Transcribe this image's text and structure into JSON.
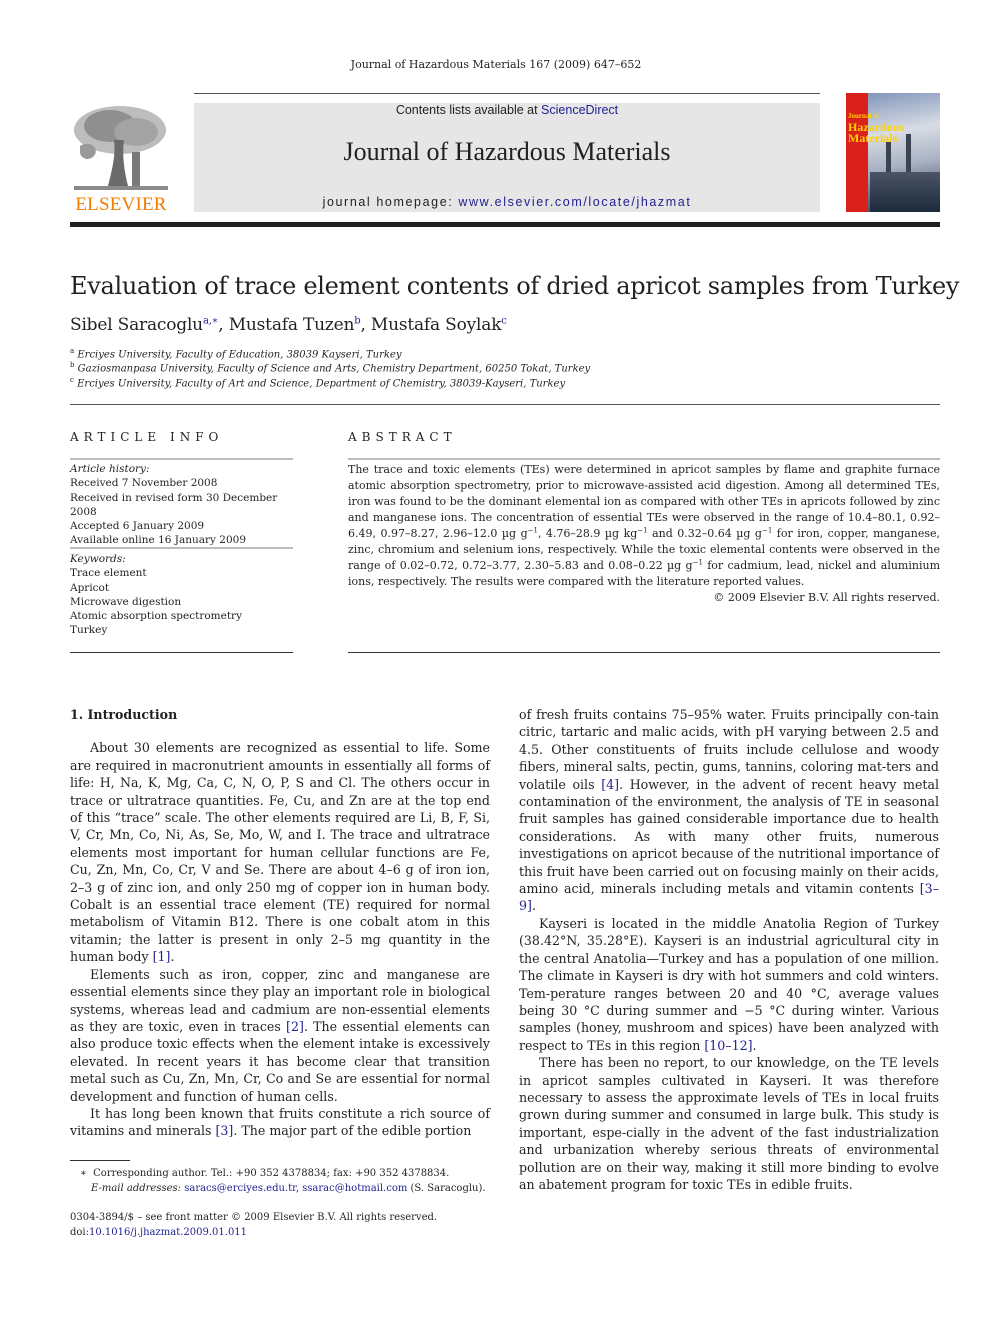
{
  "running_head": "Journal of Hazardous Materials 167 (2009) 647–652",
  "header": {
    "publisher_logo_text": "ELSEVIER",
    "contents_prefix": "Contents lists available at ",
    "contents_link": "ScienceDirect",
    "journal_title": "Journal of Hazardous Materials",
    "homepage_prefix": "journal homepage: ",
    "homepage_link": "www.elsevier.com/locate/jhazmat",
    "cover_title_line1": "Journal of",
    "cover_title_line2": "Hazardous",
    "cover_title_line3": "Materials",
    "colors": {
      "elsevier_orange": "#f07d00",
      "link_blue": "#1f1f8f",
      "masthead_gray": "#e6e6e6",
      "cover_red": "#d9201a"
    }
  },
  "article": {
    "title": "Evaluation of trace element contents of dried apricot samples from Turkey",
    "authors": [
      {
        "name": "Sibel Saracoglu",
        "sup": "a,∗",
        "sep": ", "
      },
      {
        "name": "Mustafa Tuzen",
        "sup": "b",
        "sep": ", "
      },
      {
        "name": "Mustafa Soylak",
        "sup": "c",
        "sep": ""
      }
    ],
    "affiliations": [
      {
        "key": "a",
        "text": "Erciyes University, Faculty of Education, 38039 Kayseri, Turkey"
      },
      {
        "key": "b",
        "text": "Gaziosmanpasa University, Faculty of Science and Arts, Chemistry Department, 60250 Tokat, Turkey"
      },
      {
        "key": "c",
        "text": "Erciyes University, Faculty of Art and Science, Department of Chemistry, 38039-Kayseri, Turkey"
      }
    ]
  },
  "article_info": {
    "heading": "ARTICLE INFO",
    "history_label": "Article history:",
    "history": [
      "Received 7 November 2008",
      "Received in revised form 30 December 2008",
      "Accepted 6 January 2009",
      "Available online 16 January 2009"
    ],
    "keywords_label": "Keywords:",
    "keywords": [
      "Trace element",
      "Apricot",
      "Microwave digestion",
      "Atomic absorption spectrometry",
      "Turkey"
    ]
  },
  "abstract": {
    "heading": "ABSTRACT",
    "part1": "The trace and toxic elements (TEs) were determined in apricot samples by flame and graphite furnace atomic absorption spectrometry, prior to microwave-assisted acid digestion. Among all determined TEs, iron was found to be the dominant elemental ion as compared with other TEs in apricots followed by zinc and manganese ions. The concentration of essential TEs were observed in the range of 10.4–80.1, 0.92–6.49, 0.97–8.27, 2.96–12.0 µg g",
    "part2": ", 4.76–28.9 µg kg",
    "part3": " and 0.32–0.64 µg g",
    "part4": " for iron, copper, manganese, zinc, chromium and selenium ions, respectively. While the toxic elemental contents were observed in the range of 0.02–0.72, 0.72–3.77, 2.30–5.83 and 0.08–0.22 µg g",
    "part5": " for cadmium, lead, nickel and aluminium ions, respectively. The results were compared with the literature reported values.",
    "exponent": "−1",
    "copyright": "© 2009 Elsevier B.V. All rights reserved."
  },
  "body": {
    "section_heading": "1.  Introduction",
    "left": {
      "p1a": "About 30 elements are recognized as essential to life. Some are required in macronutrient amounts in essentially all forms of life: H, Na, K, Mg, Ca, C, N, O, P, S and Cl. The others occur in trace or ultratrace quantities. Fe, Cu, and Zn are at the top end of this “trace” scale. The other elements required are Li, B, F, Si, V, Cr, Mn, Co, Ni, As, Se, Mo, W, and I. The trace and ultratrace elements most important for human cellular functions are Fe, Cu, Zn, Mn, Co, Cr, V and Se. There are about 4–6 g of iron ion, 2–3 g of zinc ion, and only 250 mg of copper ion in human body. Cobalt is an essential trace element (TE) required for normal metabolism of Vitamin B12. There is one cobalt atom in this vitamin; the latter is present in only 2–5 mg quantity in the human body ",
      "p1ref": "[1]",
      "p1b": ".",
      "p2a": "Elements such as iron, copper, zinc and manganese are essential elements since they play an important role in biological systems, whereas lead and cadmium are non-essential elements as they are toxic, even in traces ",
      "p2ref": "[2]",
      "p2b": ". The essential elements can also produce toxic effects when the element intake is excessively elevated. In recent years it has become clear that transition metal such as Cu, Zn, Mn, Cr, Co and Se are essential for normal development and function of human cells.",
      "p3a": "It has long been known that fruits constitute a rich source of vitamins and minerals ",
      "p3ref": "[3]",
      "p3b": ". The major part of the edible portion"
    },
    "right": {
      "p1a": "of fresh fruits contains 75–95% water. Fruits principally con-tain citric, tartaric and malic acids, with pH varying between 2.5 and 4.5. Other constituents of fruits include cellulose and woody fibers, mineral salts, pectin, gums, tannins, coloring mat-ters and volatile oils ",
      "p1ref1": "[4]",
      "p1b": ". However, in the advent of recent heavy metal contamination of the environment, the analysis of TE in seasonal fruit samples has gained considerable importance due to health considerations. As with many other fruits, numerous investigations on apricot because of the nutritional importance of this fruit have been carried out on focusing mainly on their acids, amino acid, minerals including metals and vitamin contents ",
      "p1ref2": "[3–9]",
      "p1c": ".",
      "p2a": "Kayseri is located in the middle Anatolia Region of Turkey (38.42°N, 35.28°E). Kayseri is an industrial agricultural city in the central Anatolia—Turkey and has a population of one million. The climate in Kayseri is dry with hot summers and cold winters. Tem-perature ranges between 20 and 40 °C, average values being 30 °C during summer and −5 °C during winter. Various samples (honey, mushroom and spices) have been analyzed with respect to TEs in this region ",
      "p2ref": "[10–12]",
      "p2b": ".",
      "p3": "There has been no report, to our knowledge, on the TE levels in apricot samples cultivated in Kayseri. It was therefore necessary to assess the approximate levels of TEs in local fruits grown during summer and consumed in large bulk. This study is important, espe-cially in the advent of the fast industrialization and urbanization whereby serious threats of environmental pollution are on their way, making it still more binding to evolve an abatement program for toxic TEs in edible fruits."
    }
  },
  "footnotes": {
    "star": "∗",
    "corresponding": "Corresponding author. Tel.: +90 352 4378834; fax: +90 352 4378834.",
    "email_label": "E-mail addresses:",
    "email1": "saracs@erciyes.edu.tr",
    "email_sep": ", ",
    "email2": "ssarac@hotmail.com",
    "email_suffix": " (S. Saracoglu).",
    "front_matter": "0304-3894/$ – see front matter © 2009 Elsevier B.V. All rights reserved.",
    "doi_label": "doi:",
    "doi": "10.1016/j.jhazmat.2009.01.011"
  }
}
